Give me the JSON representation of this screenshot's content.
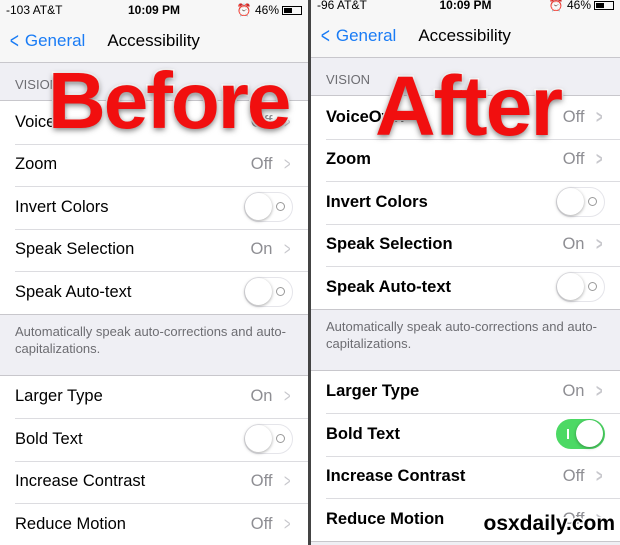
{
  "left": {
    "status": {
      "carrier": "-103 AT&T",
      "time": "10:09 PM",
      "battery": "46%"
    },
    "nav": {
      "back": "General",
      "title": "Accessibility"
    },
    "section": "VISION",
    "group1": [
      {
        "label": "VoiceOver",
        "value": "Off",
        "type": "link"
      },
      {
        "label": "Zoom",
        "value": "Off",
        "type": "link"
      },
      {
        "label": "Invert Colors",
        "type": "switch",
        "on": false
      },
      {
        "label": "Speak Selection",
        "value": "On",
        "type": "link"
      },
      {
        "label": "Speak Auto-text",
        "type": "switch",
        "on": false
      }
    ],
    "footer": "Automatically speak auto-corrections and auto-capitalizations.",
    "group2": [
      {
        "label": "Larger Type",
        "value": "On",
        "type": "link"
      },
      {
        "label": "Bold Text",
        "type": "switch",
        "on": false
      },
      {
        "label": "Increase Contrast",
        "value": "Off",
        "type": "link"
      },
      {
        "label": "Reduce Motion",
        "value": "Off",
        "type": "link"
      }
    ]
  },
  "right": {
    "status": {
      "carrier": "-96 AT&T",
      "time": "10:09 PM",
      "battery": "46%"
    },
    "nav": {
      "back": "General",
      "title": "Accessibility"
    },
    "section": "VISION",
    "group1": [
      {
        "label": "VoiceOver",
        "value": "Off",
        "type": "link"
      },
      {
        "label": "Zoom",
        "value": "Off",
        "type": "link"
      },
      {
        "label": "Invert Colors",
        "type": "switch",
        "on": false
      },
      {
        "label": "Speak Selection",
        "value": "On",
        "type": "link"
      },
      {
        "label": "Speak Auto-text",
        "type": "switch",
        "on": false
      }
    ],
    "footer": "Automatically speak auto-corrections and auto-capitalizations.",
    "group2": [
      {
        "label": "Larger Type",
        "value": "On",
        "type": "link"
      },
      {
        "label": "Bold Text",
        "type": "switch",
        "on": true
      },
      {
        "label": "Increase Contrast",
        "value": "Off",
        "type": "link"
      },
      {
        "label": "Reduce Motion",
        "value": "Off",
        "type": "link"
      }
    ]
  },
  "overlay": {
    "before": "Before",
    "after": "After",
    "watermark": "osxdaily.com"
  },
  "colors": {
    "accent": "#1a7cf5",
    "switch_on": "#4cd964",
    "overlay_text": "#f10f0f"
  }
}
